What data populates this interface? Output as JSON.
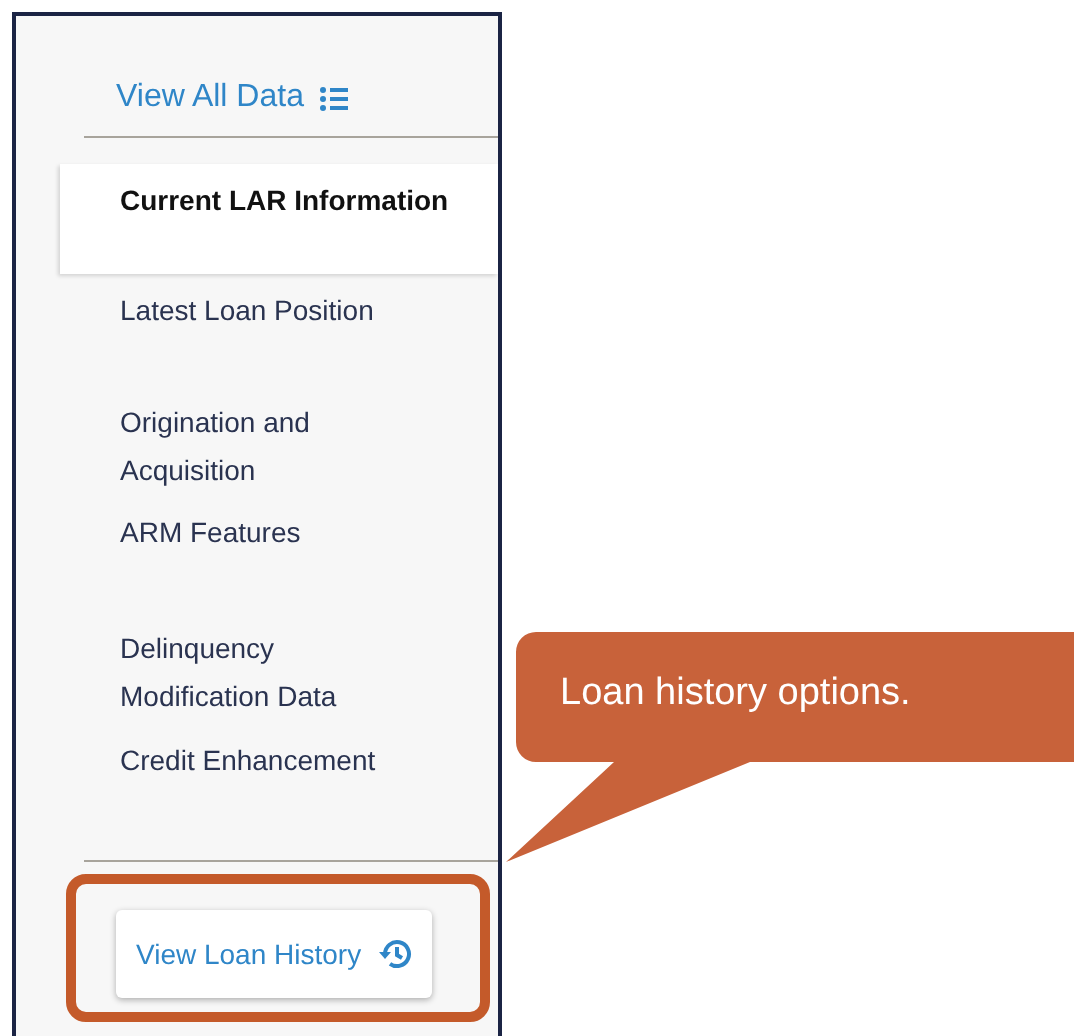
{
  "view_all_link": {
    "label": "View All Data"
  },
  "nav_items": [
    {
      "label": "Current LAR Information",
      "selected": true
    },
    {
      "label": "Latest Loan Position",
      "selected": false
    },
    {
      "label": "Origination and Acquisition",
      "selected": false
    },
    {
      "label": "ARM Features",
      "selected": false
    },
    {
      "label": "Delinquency",
      "selected": false
    },
    {
      "label": "Modification Data",
      "selected": false
    },
    {
      "label": "Credit Enhancement",
      "selected": false
    }
  ],
  "history_button": {
    "label": "View Loan History"
  },
  "callout": {
    "text": "Loan history options."
  }
}
